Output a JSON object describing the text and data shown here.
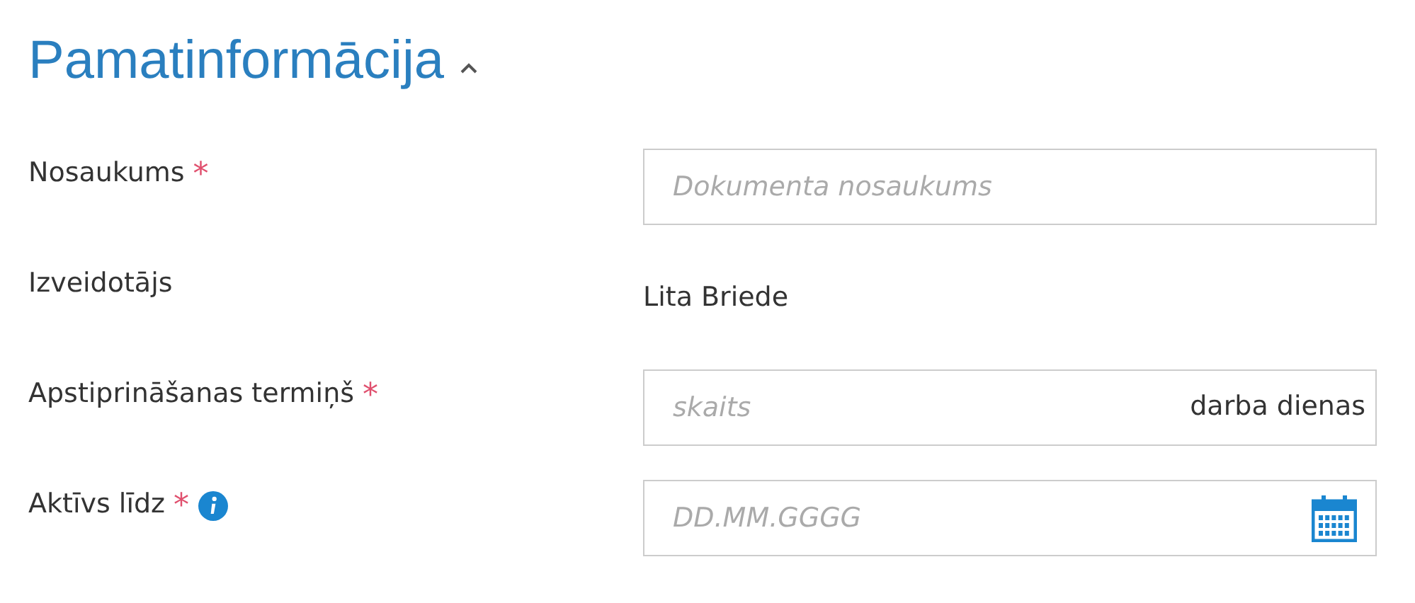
{
  "section": {
    "title": "Pamatinformācija",
    "expanded": true
  },
  "fields": [
    {
      "kind": "input",
      "label": "Nosaukums",
      "required_mark": "*",
      "placeholder": "Dokumenta nosaukums"
    },
    {
      "kind": "text",
      "label": "Izveidotājs",
      "value": "Lita Briede"
    },
    {
      "kind": "suffix",
      "label": "Apstiprināšanas termiņš",
      "required_mark": "*",
      "placeholder": "skaits",
      "suffix": "darba dienas"
    },
    {
      "kind": "date",
      "label": "Aktīvs līdz",
      "required_mark": "*",
      "info": true,
      "placeholder": "DD.MM.GGGG"
    }
  ]
}
